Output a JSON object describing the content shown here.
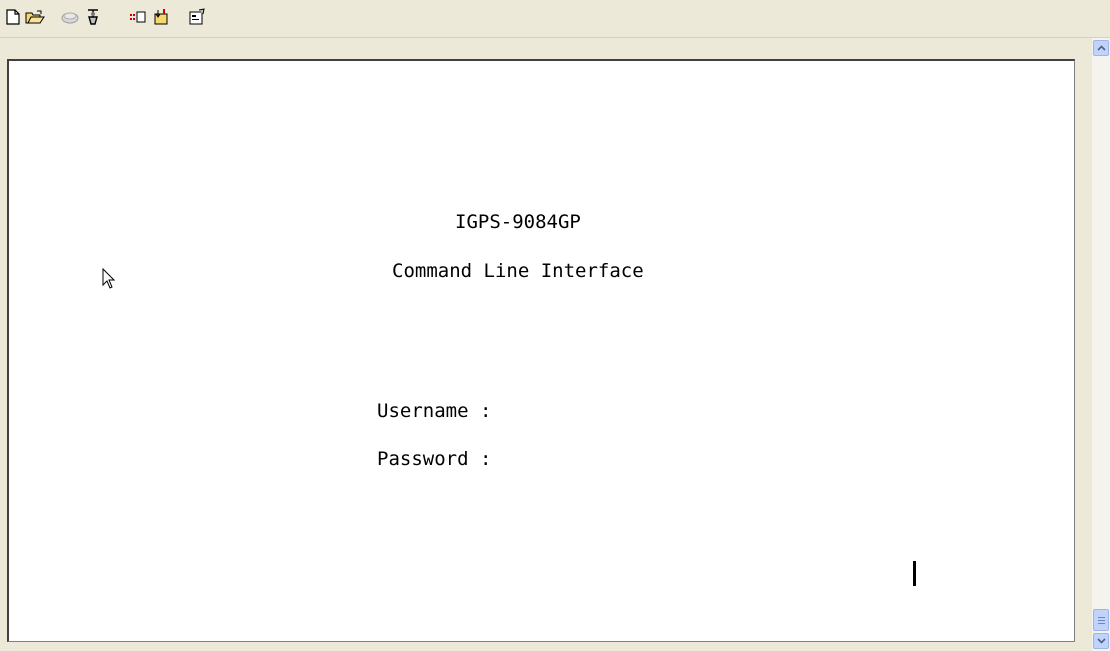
{
  "toolbar": {
    "buttons": [
      {
        "icon": "new-document-icon"
      },
      {
        "icon": "open-folder-icon"
      },
      {
        "icon": "disconnect-icon"
      },
      {
        "icon": "call-icon"
      },
      {
        "icon": "send-icon"
      },
      {
        "icon": "receive-icon"
      },
      {
        "icon": "properties-icon"
      }
    ]
  },
  "terminal": {
    "device_name": "IGPS-9084GP",
    "subtitle": "Command Line Interface",
    "username_prompt": "Username :",
    "password_prompt": "Password :"
  },
  "colors": {
    "window_bg": "#ece9d8",
    "terminal_bg": "#ffffff",
    "text": "#000000",
    "scrollbar_button": "#c1d3fb"
  }
}
